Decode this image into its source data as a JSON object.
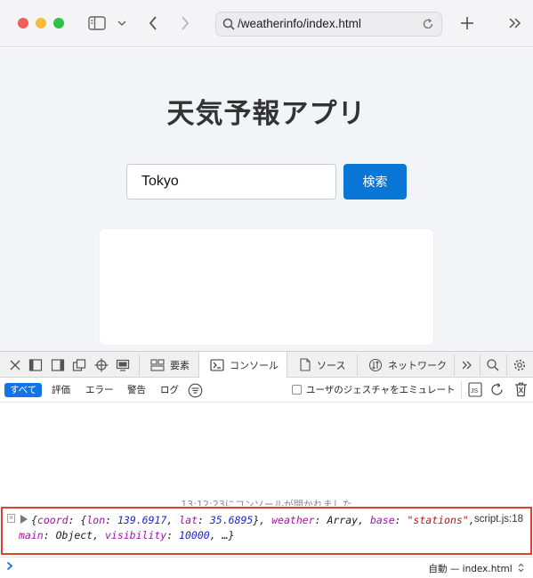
{
  "browser": {
    "url": "/weatherinfo/index.html",
    "traffic_lights": {
      "close": "#ee5f57",
      "minimize": "#f5bd3b",
      "zoom": "#2fc244"
    }
  },
  "page": {
    "title": "天気予報アプリ",
    "city_input_value": "Tokyo",
    "search_button_label": "検索",
    "accent_color": "#0a77d6"
  },
  "devtools": {
    "tabs": [
      {
        "label": "要素",
        "icon": "elements-icon"
      },
      {
        "label": "コンソール",
        "icon": "console-icon",
        "active": true
      },
      {
        "label": "ソース",
        "icon": "sources-icon"
      },
      {
        "label": "ネットワーク",
        "icon": "network-icon"
      }
    ],
    "filters": {
      "all": "すべて",
      "evaluation": "評価",
      "error": "エラー",
      "warning": "警告",
      "log": "ログ"
    },
    "emulate_gesture_label": "ユーザのジェスチャをエミュレート",
    "console_opened_message": "13:12:23にコンソールが開かれました",
    "log": {
      "source": "script.js:18",
      "line1": {
        "open": "{",
        "coord_key": "coord",
        "lon_key": "lon",
        "lon_value": "139.6917",
        "lat_key": "lat",
        "lat_value": "35.6895",
        "weather_key": "weather",
        "weather_value": "Array",
        "base_key": "base",
        "base_value": "\"stations\""
      },
      "line2": {
        "main_key": "main",
        "main_value": "Object",
        "visibility_key": "visibility",
        "visibility_value": "10000",
        "tail": "…}"
      }
    },
    "execution_context": "自動 — index.html"
  }
}
